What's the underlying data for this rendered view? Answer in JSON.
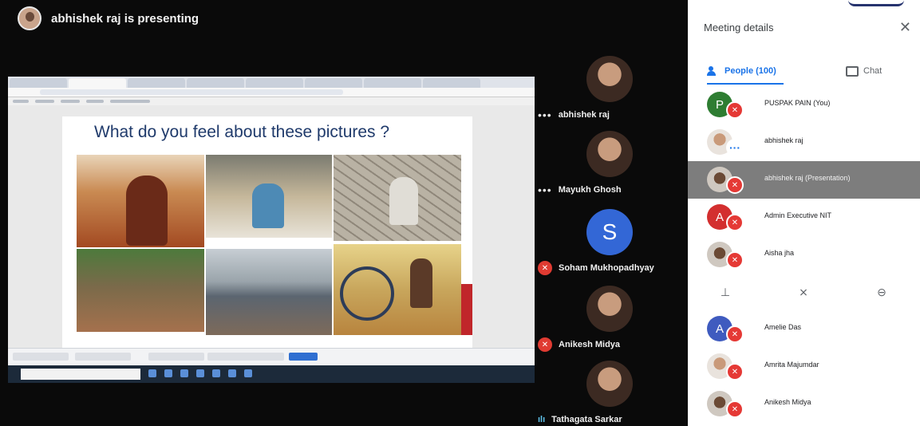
{
  "presenter": {
    "text": "abhishek raj is presenting"
  },
  "slide": {
    "title": "What do you feel about these pictures ?"
  },
  "tiles": [
    {
      "name": "abhishek raj",
      "status": "dots",
      "avatar": "photo"
    },
    {
      "name": "Mayukh Ghosh",
      "status": "dots",
      "avatar": "photo"
    },
    {
      "name": "Soham Mukhopadhyay",
      "status": "muted",
      "avatar": "letter",
      "letter": "S"
    },
    {
      "name": "Anikesh Midya",
      "status": "muted",
      "avatar": "photo"
    },
    {
      "name": "Tathagata Sarkar",
      "status": "speaking",
      "avatar": "photo"
    }
  ],
  "panel": {
    "title": "Meeting details",
    "tabs": {
      "people": "People (100)",
      "chat": "Chat"
    },
    "people": [
      {
        "name": "PUSPAK PAIN (You)",
        "letter": "P",
        "color": "#2e7d32",
        "badge": "muted"
      },
      {
        "name": "abhishek raj",
        "letter": "",
        "badge": "dots"
      },
      {
        "name": "abhishek raj (Presentation)",
        "letter": "",
        "badge": "muted",
        "selected": true
      },
      {
        "name": "Admin Executive NIT",
        "letter": "A",
        "color": "#d32f2f",
        "badge": "muted"
      },
      {
        "name": "Aisha jha",
        "letter": "",
        "badge": "muted"
      }
    ],
    "people_more": [
      {
        "name": "Amelie Das",
        "letter": "A",
        "color": "#3f5bbf",
        "badge": "muted"
      },
      {
        "name": "Amrita Majumdar",
        "letter": "",
        "badge": "muted"
      },
      {
        "name": "Anikesh Midya",
        "letter": "",
        "badge": "muted"
      }
    ]
  },
  "icons": {
    "close": "close-icon",
    "pin": "pin-icon",
    "mute": "mic-off-icon",
    "remove": "remove-circle-icon"
  },
  "colors": {
    "accent": "#1a73e8",
    "muted_red": "#e53935"
  }
}
